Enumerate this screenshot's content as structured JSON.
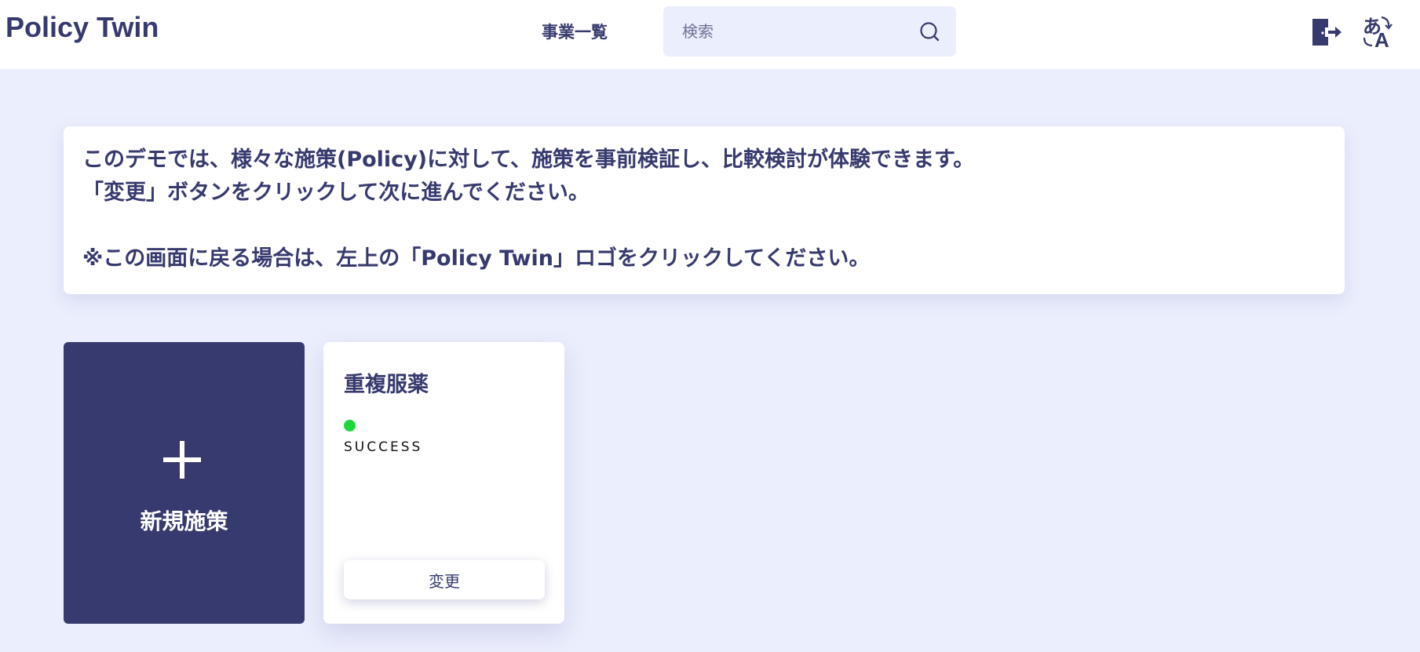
{
  "header": {
    "logo": "Policy Twin",
    "nav_link": "事業一覧",
    "search": {
      "placeholder": "検索",
      "value": "",
      "icon": "search-icon"
    },
    "icons": [
      "logout-icon",
      "translate-icon"
    ]
  },
  "info": {
    "line1": "このデモでは、様々な施策(Policy)に対して、施策を事前検証し、比較検討が体験できます。",
    "line2": "「変更」ボタンをクリックして次に進んでください。",
    "line3": "※この画面に戻る場合は、左上の「Policy Twin」ロゴをクリックしてください。"
  },
  "new_card": {
    "icon": "plus-icon",
    "label": "新規施策"
  },
  "policies": [
    {
      "title": "重複服薬",
      "status": "SUCCESS",
      "button_label": "変更"
    }
  ],
  "colors": {
    "primary": "#373a6e",
    "background": "#ebeefc",
    "success": "#1ed83a"
  }
}
